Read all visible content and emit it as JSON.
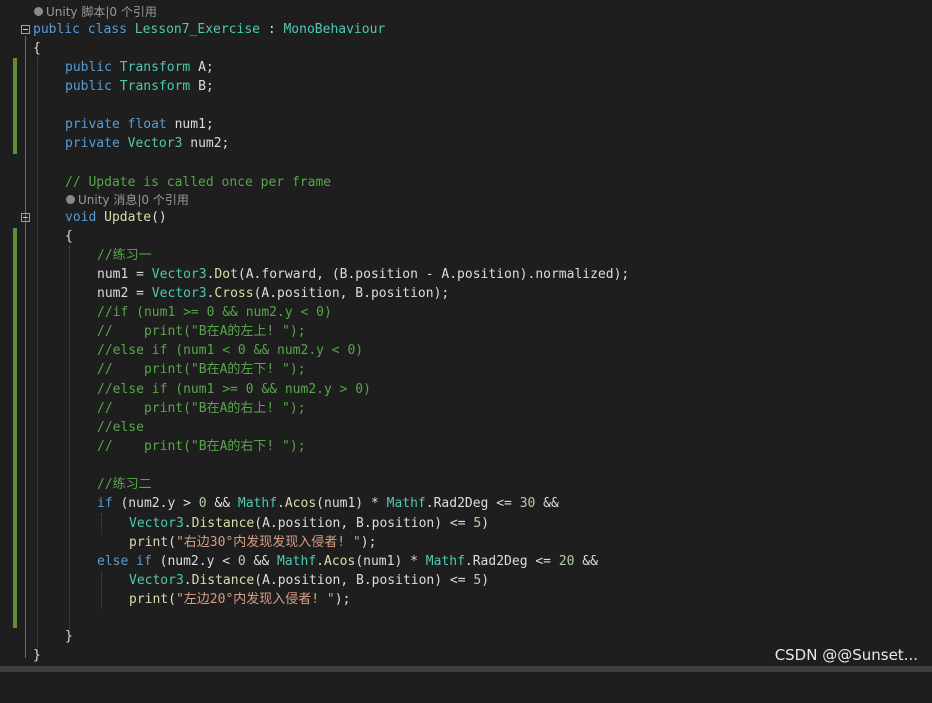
{
  "lens_top": "Unity 脚本|0 个引用",
  "lens_update": "Unity 消息|0 个引用",
  "class_decl": {
    "kw1": "public",
    "kw2": "class",
    "name": "Lesson7_Exercise",
    "colon": " : ",
    "base": "MonoBehaviour"
  },
  "open_brace": "{",
  "close_brace": "}",
  "field_a": {
    "kw": "public",
    "type": "Transform",
    "name": "A;"
  },
  "field_b": {
    "kw": "public",
    "type": "Transform",
    "name": "B;"
  },
  "field_num1": {
    "kw": "private",
    "type": "float",
    "name": "num1;"
  },
  "field_num2": {
    "kw": "private",
    "type": "Vector3",
    "name": "num2;"
  },
  "comment_update": "// Update is called once per frame",
  "update_decl": {
    "kw": "void",
    "fn": "Update",
    "rest": "()"
  },
  "method_open": "{",
  "method_close": "}",
  "c_ex1": "//练习一",
  "l_num1": {
    "a": "num1 = ",
    "t": "Vector3",
    "dot": ".",
    "f": "Dot",
    "rest": "(A.forward, (B.position - A.position).normalized);"
  },
  "l_num2": {
    "a": "num2 = ",
    "t": "Vector3",
    "dot": ".",
    "f": "Cross",
    "rest": "(A.position, B.position);"
  },
  "c1": "//if (num1 >= 0 && num2.y < 0)",
  "c2": "//    print(\"B在A的左上! \");",
  "c3": "//else if (num1 < 0 && num2.y < 0)",
  "c4": "//    print(\"B在A的左下! \");",
  "c5": "//else if (num1 >= 0 && num2.y > 0)",
  "c6": "//    print(\"B在A的右上! \");",
  "c7": "//else",
  "c8": "//    print(\"B在A的右下! \");",
  "c_ex2": "//练习二",
  "if1": {
    "kw": "if",
    "a": " (num2.y > ",
    "n0": "0",
    "b": " && ",
    "t": "Mathf",
    "dot": ".",
    "f": "Acos",
    "c": "(num1) * ",
    "t2": "Mathf",
    "d": ".Rad2Deg <= ",
    "n": "30",
    "e": " &&"
  },
  "if1b": {
    "t": "Vector3",
    "dot": ".",
    "f": "Distance",
    "a": "(A.position, B.position) <= ",
    "n": "5",
    "e": ")"
  },
  "print1": {
    "f": "print",
    "a": "(",
    "s": "\"右边30°内发现发现入侵者! \"",
    "e": ");"
  },
  "if2": {
    "kw": "else if",
    "a": " (num2.y < ",
    "n0": "0",
    "b": " && ",
    "t": "Mathf",
    "dot": ".",
    "f": "Acos",
    "c": "(num1) * ",
    "t2": "Mathf",
    "d": ".Rad2Deg <= ",
    "n": "20",
    "e": " &&"
  },
  "if2b": {
    "t": "Vector3",
    "dot": ".",
    "f": "Distance",
    "a": "(A.position, B.position) <= ",
    "n": "5",
    "e": ")"
  },
  "print2": {
    "f": "print",
    "a": "(",
    "s": "\"左边20°内发现入侵者! \"",
    "e": ");"
  },
  "watermark": "CSDN @@Sunset...",
  "colors": {
    "background": "#1e1e1e",
    "keyword": "#569cd6",
    "type": "#4ec9b0",
    "function": "#dcdcaa",
    "comment": "#57a64a",
    "string": "#d69d85",
    "number": "#b5cea8",
    "change_bar": "#5d8f38"
  }
}
